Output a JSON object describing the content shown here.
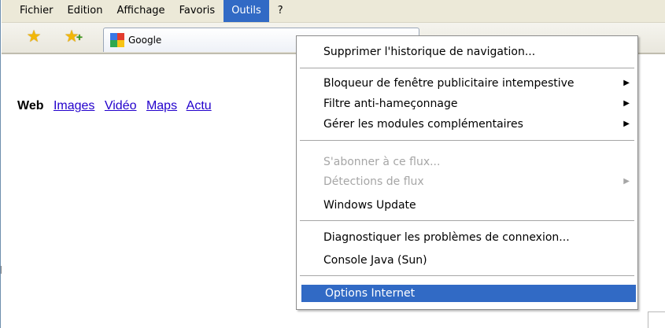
{
  "menubar": {
    "items": [
      "Fichier",
      "Edition",
      "Affichage",
      "Favoris",
      "Outils",
      "?"
    ],
    "active": "Outils",
    "active_color": "#316ac5"
  },
  "toolbar": {
    "favorites_icon": "star-icon",
    "add_favorite_icon": "star-add-icon",
    "tab": {
      "label": "Google",
      "icon": "google-icon"
    }
  },
  "page": {
    "nav": {
      "web": "Web",
      "links": [
        "Images",
        "Vidéo",
        "Maps",
        "Actu"
      ]
    }
  },
  "dropdown": {
    "items": [
      {
        "label": "Supprimer l'historique de navigation...",
        "enabled": true,
        "submenu": false
      },
      {
        "label": "Bloqueur de fenêtre publicitaire intempestive",
        "enabled": true,
        "submenu": true
      },
      {
        "label": "Filtre anti-hameçonnage",
        "enabled": true,
        "submenu": true
      },
      {
        "label": "Gérer les modules complémentaires",
        "enabled": true,
        "submenu": true
      },
      {
        "label": "S'abonner à ce flux...",
        "enabled": false,
        "submenu": false
      },
      {
        "label": "Détections de flux",
        "enabled": false,
        "submenu": true
      },
      {
        "label": "Windows Update",
        "enabled": true,
        "submenu": false
      },
      {
        "label": "Diagnostiquer les problèmes de connexion...",
        "enabled": true,
        "submenu": false
      },
      {
        "label": "Console Java (Sun)",
        "enabled": true,
        "submenu": false
      },
      {
        "label": "Options Internet",
        "enabled": true,
        "submenu": false,
        "highlighted": true
      }
    ],
    "submenu_arrow": "▶"
  }
}
